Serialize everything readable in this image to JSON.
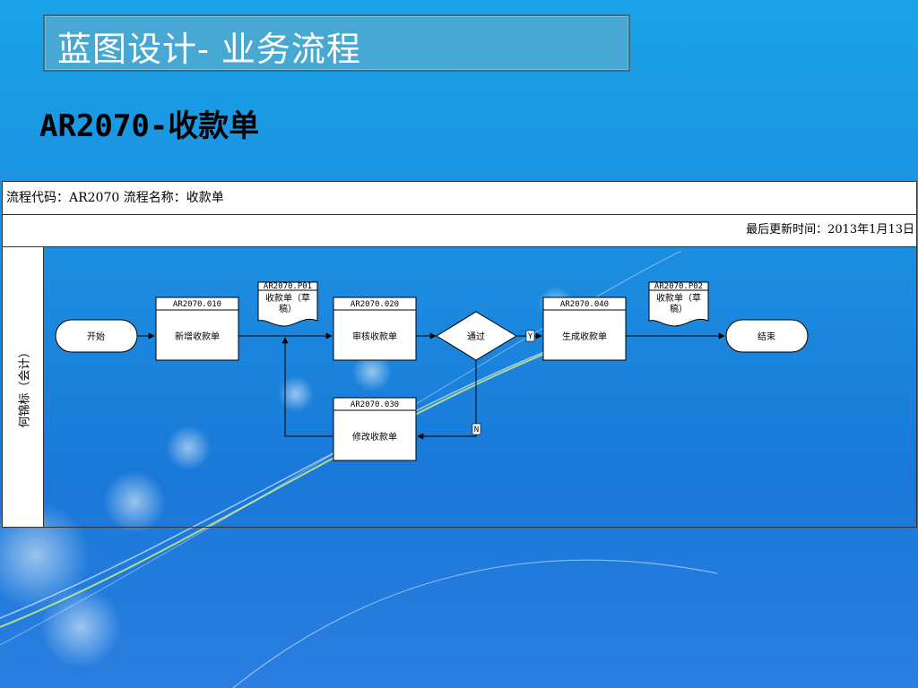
{
  "slide": {
    "title": "蓝图设计- 业务流程",
    "subtitle": "AR2070-收款单"
  },
  "flow_table": {
    "header_row": "流程代码：AR2070  流程名称：收款单",
    "updated_row": "最后更新时间：2013年1月13日",
    "swimlane_label": "何锦标（会计）"
  },
  "diagram": {
    "start": "开始",
    "end": "结束",
    "steps": [
      {
        "code": "AR2070.010",
        "label": "新增收款单"
      },
      {
        "code": "AR2070.020",
        "label": "审核收款单"
      },
      {
        "code": "AR2070.030",
        "label": "修改收款单"
      },
      {
        "code": "AR2070.040",
        "label": "生成收款单"
      }
    ],
    "decision": "通过",
    "documents": [
      {
        "code": "AR2070.P01",
        "line1": "收款单（草",
        "line2": "稿）"
      },
      {
        "code": "AR2070.P02",
        "line1": "收款单（草",
        "line2": "稿）"
      }
    ],
    "branch_yes": "Y",
    "branch_no": "N"
  }
}
